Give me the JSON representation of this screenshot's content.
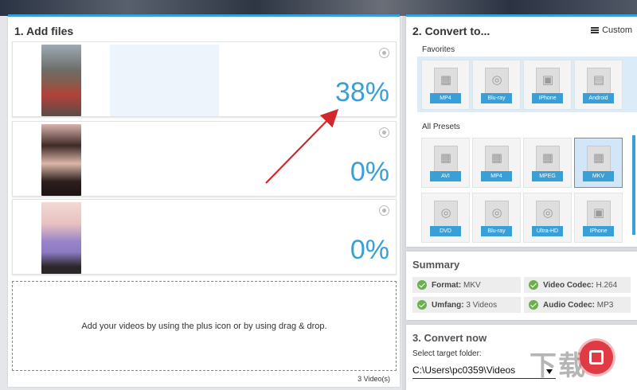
{
  "files_panel": {
    "title": "1. Add files",
    "files": [
      {
        "progress": "38%",
        "thumb_caption": "…"
      },
      {
        "progress": "0%"
      },
      {
        "progress": "0%"
      }
    ],
    "drop_hint": "Add your videos by using the plus icon or by using drag & drop.",
    "video_count": "3 Video(s)"
  },
  "convert_panel": {
    "title": "2. Convert to...",
    "custom_label": "Custom",
    "favorites_label": "Favorites",
    "favorites": [
      {
        "label": "MP4",
        "icon": "film-icon"
      },
      {
        "label": "Blu-ray",
        "icon": "disc-icon"
      },
      {
        "label": "IPhone",
        "icon": "apple-icon"
      },
      {
        "label": "Android",
        "icon": "android-icon"
      }
    ],
    "all_presets_label": "All Presets",
    "presets": [
      {
        "label": "AVI",
        "icon": "film-icon",
        "selected": false
      },
      {
        "label": "MP4",
        "icon": "film-icon",
        "selected": false
      },
      {
        "label": "MPEG",
        "icon": "film-icon",
        "selected": false
      },
      {
        "label": "MKV",
        "icon": "film-icon",
        "selected": true
      },
      {
        "label": "DVD",
        "icon": "disc-icon",
        "selected": false
      },
      {
        "label": "Blu-ray",
        "icon": "disc-icon",
        "selected": false
      },
      {
        "label": "Ultra-HD",
        "icon": "disc-icon",
        "selected": false
      },
      {
        "label": "IPhone",
        "icon": "apple-icon",
        "selected": false
      }
    ]
  },
  "summary": {
    "title": "Summary",
    "format_key": "Format:",
    "format_value": "MKV",
    "video_codec_key": "Video Codec:",
    "video_codec_value": "H.264",
    "umfang_key": "Umfang:",
    "umfang_value": "3 Videos",
    "audio_codec_key": "Audio Codec:",
    "audio_codec_value": "MP3"
  },
  "convert_now": {
    "title": "3. Convert now",
    "folder_label": "Select target folder:",
    "folder_value": "C:\\Users\\pc0359\\Videos"
  },
  "colors": {
    "accent": "#3a9fd6",
    "record": "#e03a44",
    "check": "#6ab04c"
  }
}
